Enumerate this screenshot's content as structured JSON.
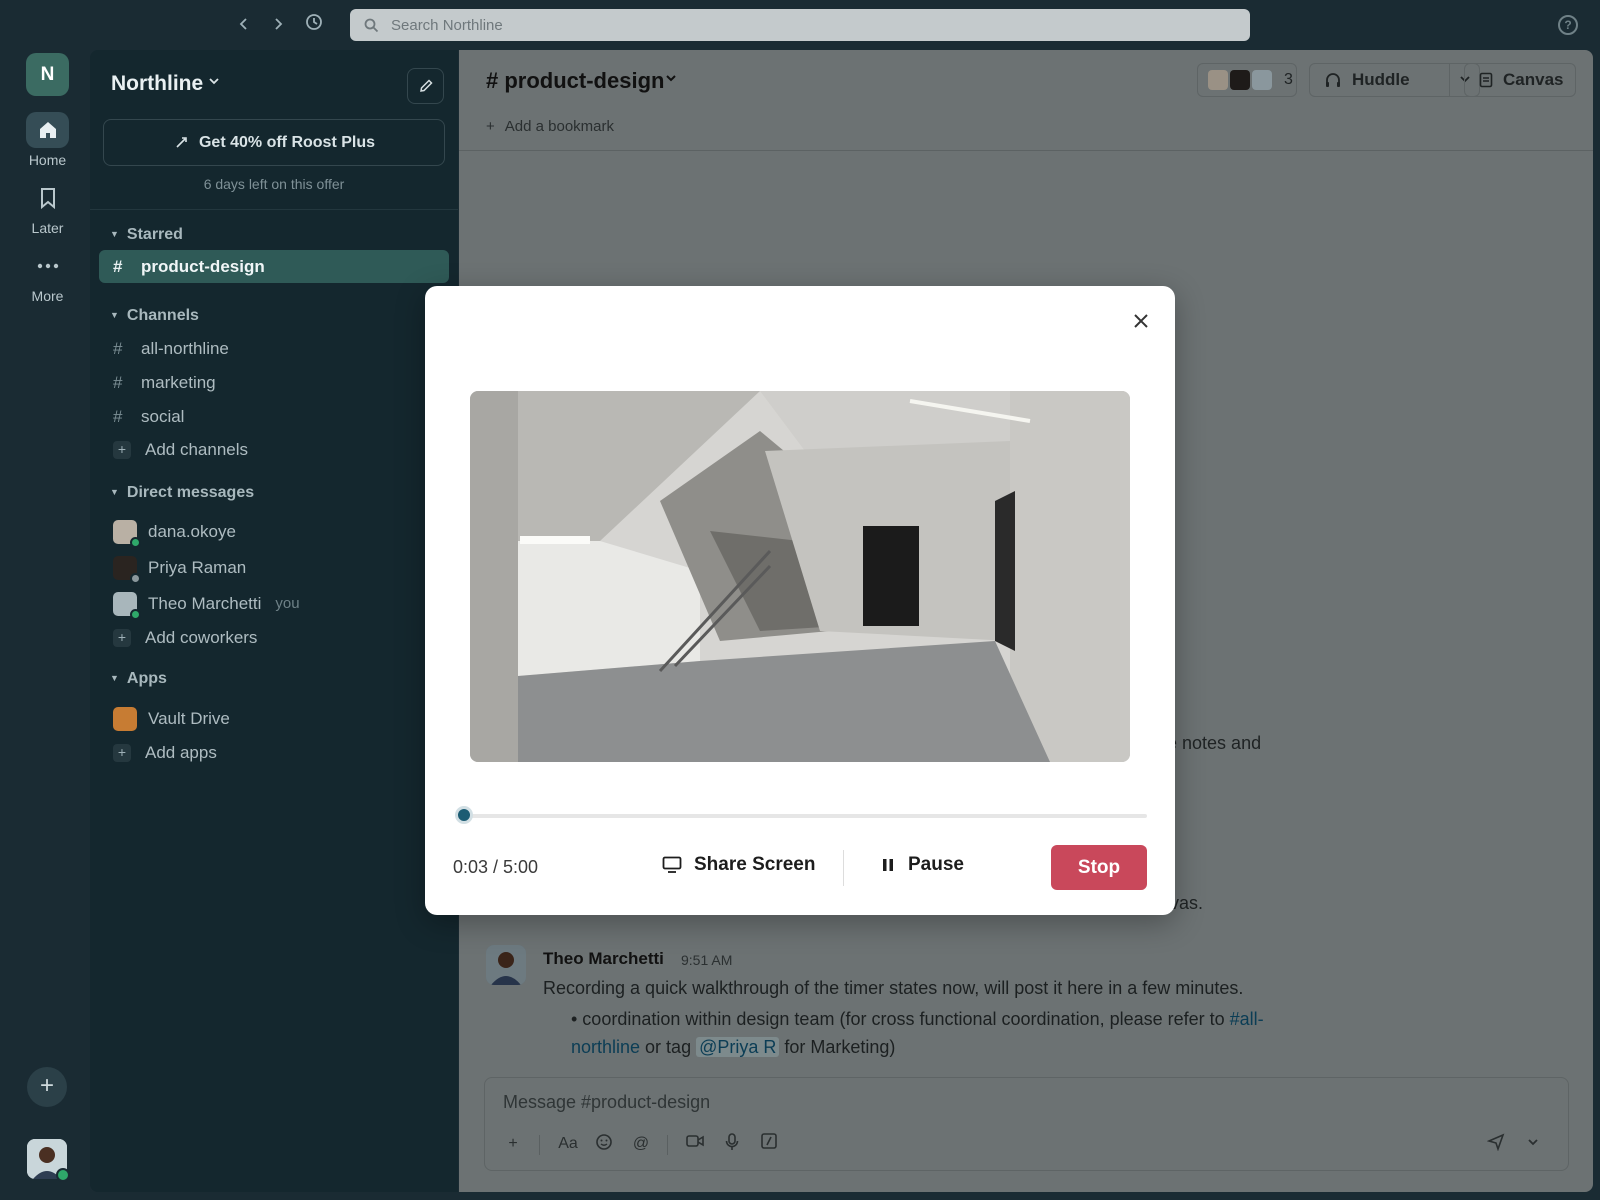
{
  "topbar": {
    "search_placeholder": "Search Northline"
  },
  "rail": {
    "workspace_initial": "N",
    "items": [
      {
        "label": "Home",
        "icon": "home-icon",
        "active": true
      },
      {
        "label": "Later",
        "icon": "bookmark-icon",
        "active": false
      },
      {
        "label": "More",
        "icon": "more-icon",
        "active": false
      }
    ]
  },
  "sidebar": {
    "workspace_name": "Northline",
    "promo_label": "Get 40% off Roost Plus",
    "promo_sub": "6 days left on this offer",
    "starred_header": "Starred",
    "starred": [
      {
        "name": "product-design",
        "active": true
      }
    ],
    "channels_header": "Channels",
    "channels": [
      {
        "name": "all-northline"
      },
      {
        "name": "marketing"
      },
      {
        "name": "social"
      }
    ],
    "add_channels": "Add channels",
    "dm_header": "Direct messages",
    "dms": [
      {
        "name": "dana.okoye",
        "status": "online",
        "status_color": "#2fa86a"
      },
      {
        "name": "Priya Raman",
        "status": "away",
        "status_color": "#8a979c"
      },
      {
        "name": "Theo Marchetti",
        "you": "you",
        "status": "online",
        "status_color": "#2fa86a"
      }
    ],
    "add_coworkers": "Add coworkers",
    "apps_header": "Apps",
    "apps": [
      {
        "name": "Vault Drive",
        "color": "#c77c33"
      }
    ],
    "add_apps": "Add apps"
  },
  "channel": {
    "title": "# product-design",
    "member_count": "3",
    "huddle_label": "Huddle",
    "canvas_label": "Canvas",
    "bookmark_label": "Add a bookmark"
  },
  "messages": {
    "fragment_1": "ue notes and",
    "fragment_2": "nvas.",
    "author": "Theo Marchetti",
    "time": "9:51 AM",
    "body": "Recording a quick walkthrough of the timer states now, will post it here in a few minutes.",
    "bullet_pre": "• coordination within design team (for cross functional coordination, please refer to ",
    "bullet_link": "#all-northline",
    "bullet_mid": " or tag ",
    "bullet_mention": "@Priya R",
    "bullet_post": " for Marketing)"
  },
  "composer": {
    "placeholder": "Message #product-design"
  },
  "recorder": {
    "timecode": "0:03 / 5:00",
    "progress": 0.01,
    "share_label": "Share Screen",
    "pause_label": "Pause",
    "stop_label": "Stop"
  },
  "colors": {
    "accent": "#1c5c73",
    "stop": "#c9485b",
    "active_channel": "#2f5a57"
  }
}
